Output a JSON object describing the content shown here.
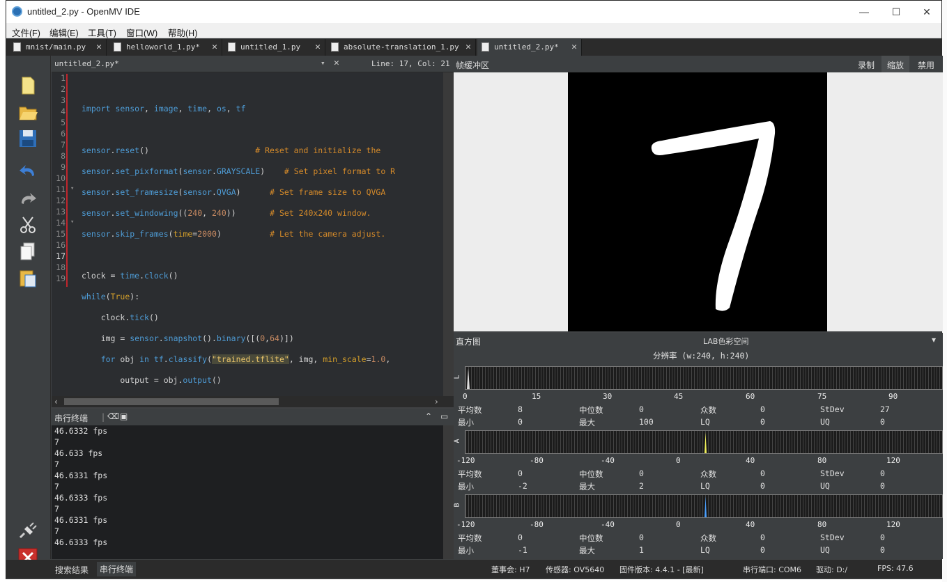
{
  "window": {
    "title": "untitled_2.py - OpenMV IDE"
  },
  "menu": [
    "文件(F)",
    "编辑(E)",
    "工具(T)",
    "窗口(W)",
    "帮助(H)"
  ],
  "tabs": [
    {
      "label": "mnist/main.py"
    },
    {
      "label": "helloworld_1.py*"
    },
    {
      "label": "untitled_1.py"
    },
    {
      "label": "absolute-translation_1.py"
    },
    {
      "label": "untitled_2.py*"
    }
  ],
  "editor": {
    "file": "untitled_2.py*",
    "position": "Line: 17, Col: 21",
    "line_numbers": [
      "1",
      "2",
      "3",
      "4",
      "5",
      "6",
      "7",
      "8",
      "9",
      "10",
      "11",
      "12",
      "13",
      "14",
      "15",
      "16",
      "17",
      "18",
      "19"
    ]
  },
  "terminal": {
    "title": "串行终端",
    "lines": [
      "46.6332 fps",
      "7",
      "46.633 fps",
      "7",
      "46.6331 fps",
      "7",
      "46.6333 fps",
      "7",
      "46.6331 fps",
      "7",
      "46.6333 fps"
    ]
  },
  "framebuffer": {
    "title": "帧缓冲区",
    "record": "录制",
    "zoom": "缩放",
    "disable": "禁用"
  },
  "histogram": {
    "title": "直方图",
    "colorspace": "LAB色彩空间",
    "resolution": "分辨率 (w:240, h:240)",
    "channels": [
      {
        "name": "L",
        "ticks": [
          "0",
          "15",
          "30",
          "45",
          "60",
          "75",
          "90"
        ],
        "mean": "8",
        "median": "0",
        "mode": "0",
        "stdev": "27",
        "min": "0",
        "max": "100",
        "lq": "0",
        "uq": "0"
      },
      {
        "name": "A",
        "ticks": [
          "-120",
          "-80",
          "-40",
          "0",
          "40",
          "80",
          "120"
        ],
        "mean": "0",
        "median": "0",
        "mode": "0",
        "stdev": "0",
        "min": "-2",
        "max": "2",
        "lq": "0",
        "uq": "0"
      },
      {
        "name": "B",
        "ticks": [
          "-120",
          "-80",
          "-40",
          "0",
          "40",
          "80",
          "120"
        ],
        "mean": "0",
        "median": "0",
        "mode": "0",
        "stdev": "0",
        "min": "-1",
        "max": "1",
        "lq": "0",
        "uq": "0"
      }
    ],
    "labels": {
      "mean": "平均数",
      "median": "中位数",
      "mode": "众数",
      "stdev": "StDev",
      "min": "最小",
      "max": "最大",
      "lq": "LQ",
      "uq": "UQ"
    }
  },
  "status": {
    "search": "搜索结果",
    "serial": "串行终端",
    "board": "董事会: H7",
    "sensor": "传感器: OV5640",
    "firmware": "固件版本: 4.4.1 - [最新]",
    "port": "串行端口: COM6",
    "drive": "驱动: D:/",
    "fps": "FPS:  47.6"
  }
}
